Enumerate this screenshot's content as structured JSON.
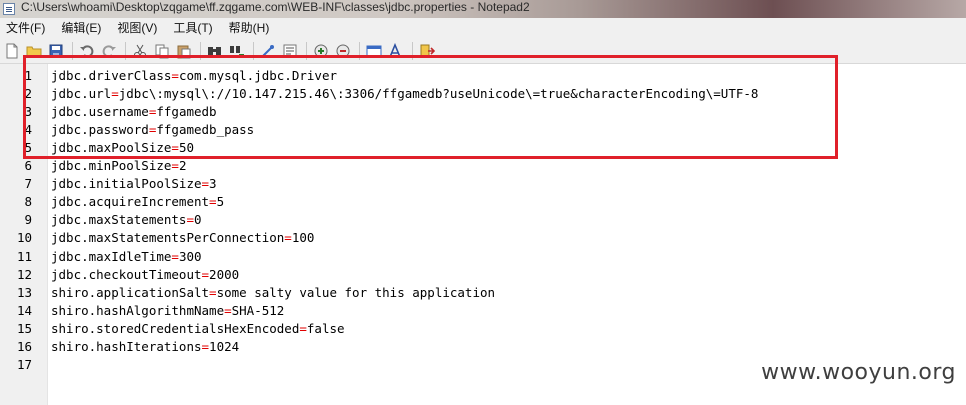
{
  "window": {
    "title": "C:\\Users\\whoami\\Desktop\\zqgame\\ff.zqgame.com\\WEB-INF\\classes\\jdbc.properties - Notepad2"
  },
  "menu": [
    "文件(F)",
    "编辑(E)",
    "视图(V)",
    "工具(T)",
    "帮助(H)"
  ],
  "toolbar": {
    "icons": [
      "new-file-icon",
      "open-folder-icon",
      "save-icon",
      "undo-icon",
      "redo-icon",
      "cut-icon",
      "copy-icon",
      "paste-icon",
      "find-icon",
      "replace-icon",
      "word-wrap-icon",
      "go-to-icon",
      "zoom-in-icon",
      "zoom-out-icon",
      "scheme-icon",
      "font-icon",
      "exit-icon"
    ]
  },
  "editor": {
    "lines": [
      {
        "num": "1",
        "key": "jdbc.driverClass",
        "sep": "=",
        "val": "com.mysql.jdbc.Driver"
      },
      {
        "num": "2",
        "key": "jdbc.url",
        "sep": "=",
        "val": "jdbc\\:mysql\\://10.147.215.46\\:3306/ffgamedb?useUnicode\\=true&characterEncoding\\=UTF-8"
      },
      {
        "num": "3",
        "key": "jdbc.username",
        "sep": "=",
        "val": "ffgamedb"
      },
      {
        "num": "4",
        "key": "jdbc.password",
        "sep": "=",
        "val": "ffgamedb_pass"
      },
      {
        "num": "5",
        "key": "jdbc.maxPoolSize",
        "sep": "=",
        "val": "50"
      },
      {
        "num": "6",
        "key": "jdbc.minPoolSize",
        "sep": "=",
        "val": "2"
      },
      {
        "num": "7",
        "key": "jdbc.initialPoolSize",
        "sep": "=",
        "val": "3"
      },
      {
        "num": "8",
        "key": "jdbc.acquireIncrement",
        "sep": "=",
        "val": "5"
      },
      {
        "num": "9",
        "key": "jdbc.maxStatements",
        "sep": "=",
        "val": "0"
      },
      {
        "num": "10",
        "key": "jdbc.maxStatementsPerConnection",
        "sep": "=",
        "val": "100"
      },
      {
        "num": "11",
        "key": "jdbc.maxIdleTime",
        "sep": "=",
        "val": "300"
      },
      {
        "num": "12",
        "key": "jdbc.checkoutTimeout",
        "sep": "=",
        "val": "2000"
      },
      {
        "num": "13",
        "key": "shiro.applicationSalt",
        "sep": "=",
        "val": "some salty value for this application"
      },
      {
        "num": "14",
        "key": "shiro.hashAlgorithmName",
        "sep": "=",
        "val": "SHA-512"
      },
      {
        "num": "15",
        "key": "shiro.storedCredentialsHexEncoded",
        "sep": "=",
        "val": "false"
      },
      {
        "num": "16",
        "key": "shiro.hashIterations",
        "sep": "=",
        "val": "1024"
      },
      {
        "num": "17",
        "key": "",
        "sep": "",
        "val": ""
      }
    ]
  },
  "watermark": "www.wooyun.org",
  "colors": {
    "separator": "#e00000",
    "highlight_box": "#e0202a"
  }
}
